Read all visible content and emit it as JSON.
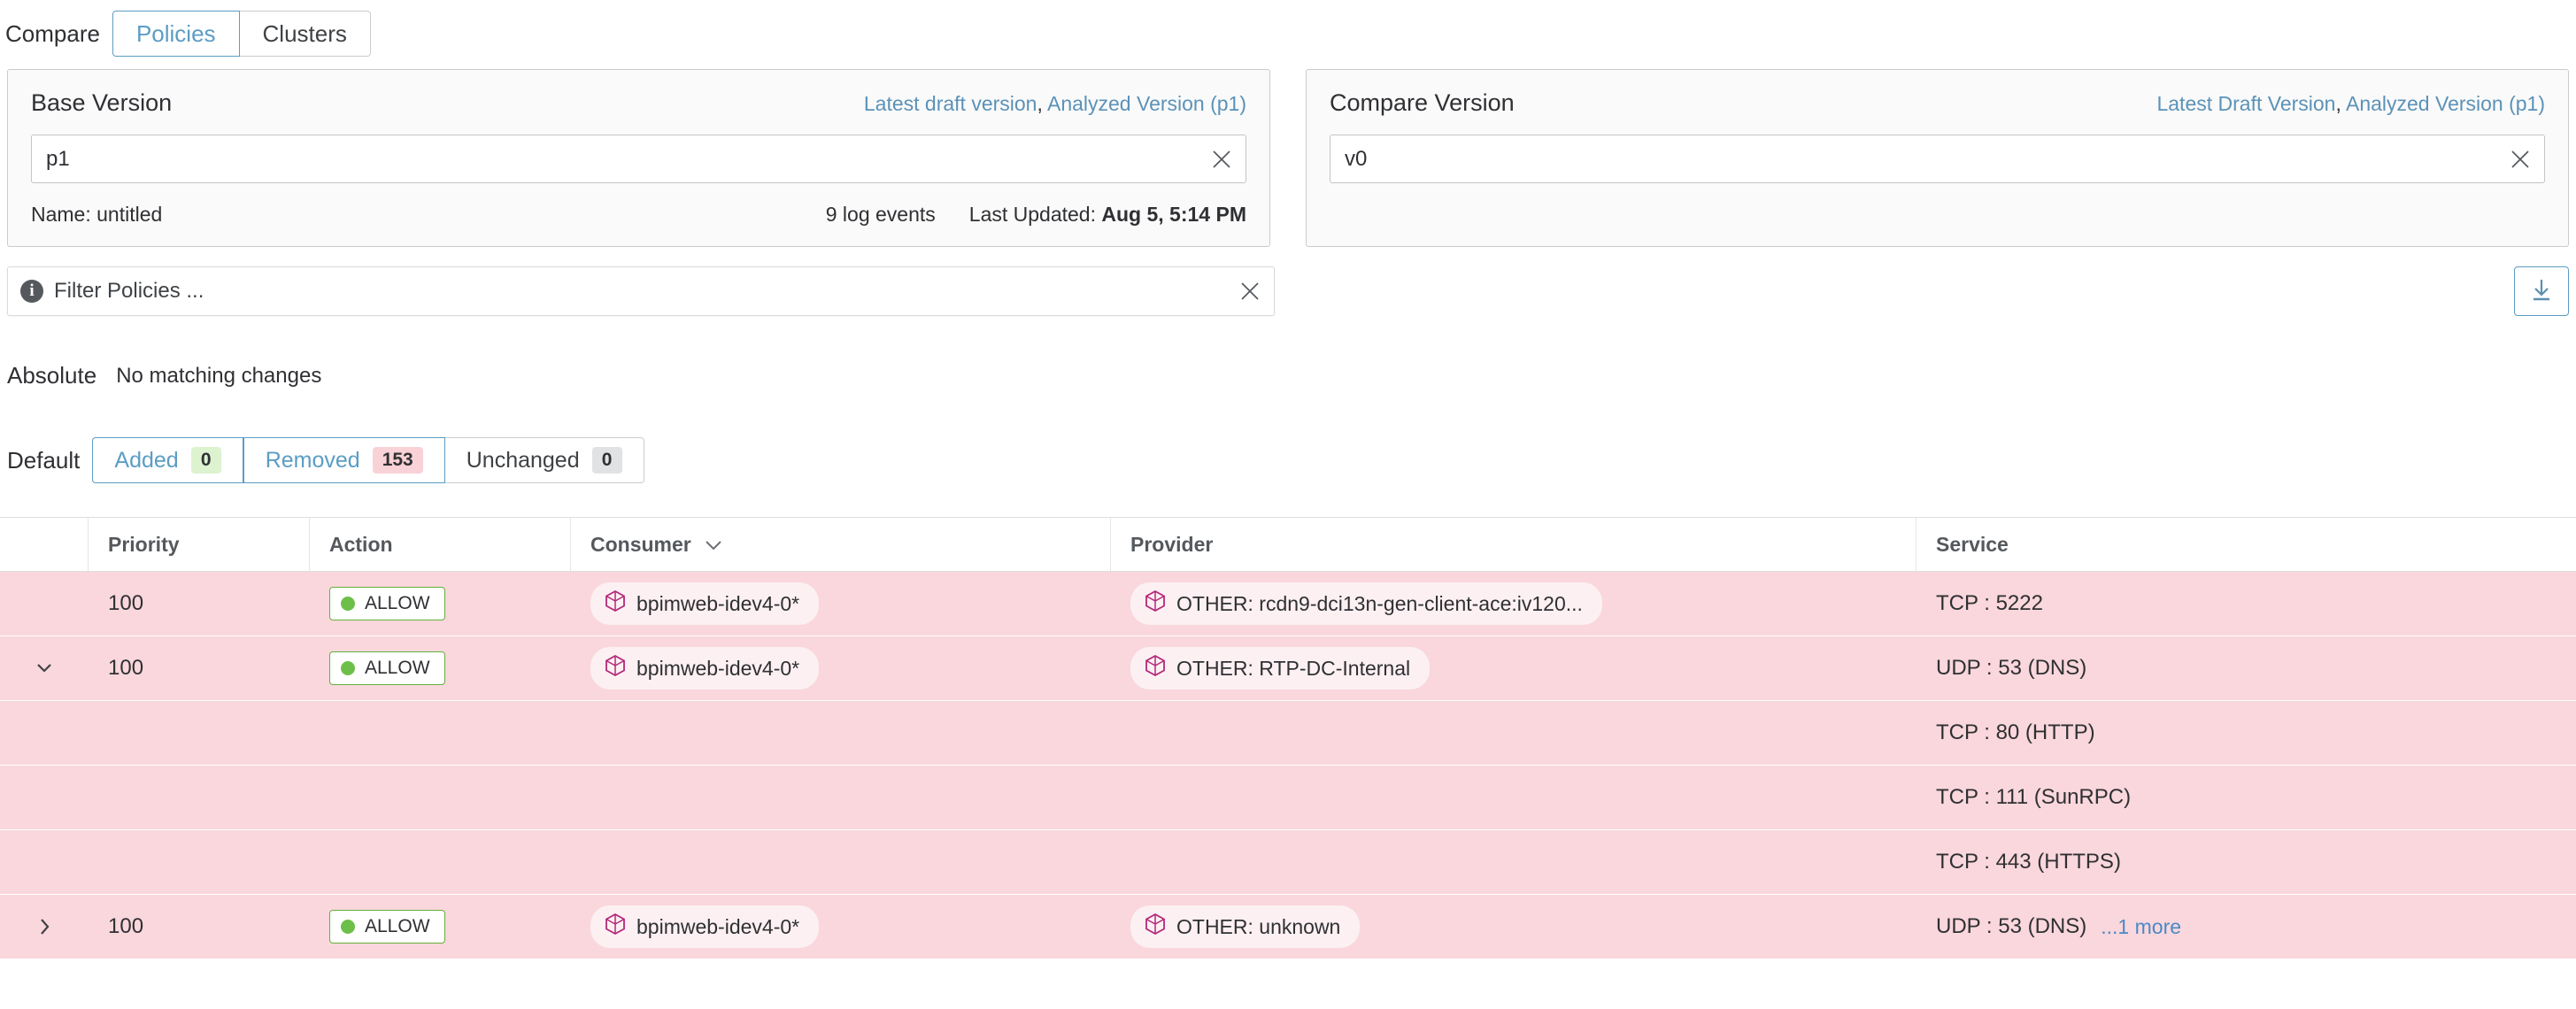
{
  "compare": {
    "label": "Compare",
    "tabs": [
      {
        "label": "Policies",
        "active": true
      },
      {
        "label": "Clusters",
        "active": false
      }
    ]
  },
  "base_version": {
    "title": "Base Version",
    "links": {
      "latest": "Latest draft version",
      "analyzed": "Analyzed Version (p1)",
      "separator": ","
    },
    "input": {
      "value": "p1",
      "placeholder": ""
    },
    "clear_icon": "close-icon",
    "meta": {
      "name": "Name: untitled",
      "log_events": "9 log events",
      "last_updated_label": "Last Updated:",
      "last_updated_value": "Aug 5, 5:14 PM"
    }
  },
  "compare_version": {
    "title": "Compare Version",
    "links": {
      "latest": "Latest Draft Version",
      "analyzed": "Analyzed Version (p1)",
      "separator": ","
    },
    "input": {
      "value": "v0",
      "placeholder": ""
    },
    "clear_icon": "close-icon"
  },
  "filter": {
    "info_icon": "info-icon",
    "placeholder": "Filter Policies ...",
    "value": "",
    "clear_icon": "close-icon",
    "download_icon": "download-icon"
  },
  "absolute": {
    "label": "Absolute",
    "message": "No matching changes"
  },
  "default_tabs": {
    "label": "Default",
    "tabs": [
      {
        "label": "Added",
        "count": "0",
        "badge": "green",
        "selected": true
      },
      {
        "label": "Removed",
        "count": "153",
        "badge": "red",
        "selected": true
      },
      {
        "label": "Unchanged",
        "count": "0",
        "badge": "grey",
        "selected": false
      }
    ]
  },
  "table": {
    "columns": [
      {
        "key": "expand",
        "label": ""
      },
      {
        "key": "priority",
        "label": "Priority"
      },
      {
        "key": "action",
        "label": "Action"
      },
      {
        "key": "consumer",
        "label": "Consumer",
        "sortable": true,
        "sort_icon": "chevron-down-icon"
      },
      {
        "key": "provider",
        "label": "Provider"
      },
      {
        "key": "service",
        "label": "Service"
      }
    ],
    "rows": [
      {
        "state": "removed",
        "expand": "none",
        "priority": "100",
        "action": "ALLOW",
        "consumer": "bpimweb-idev4-0*",
        "provider": "OTHER: rcdn9-dci13n-gen-client-ace:iv120...",
        "service": "TCP : 5222",
        "more": ""
      },
      {
        "state": "removed",
        "expand": "expanded",
        "priority": "100",
        "action": "ALLOW",
        "consumer": "bpimweb-idev4-0*",
        "provider": "OTHER: RTP-DC-Internal",
        "service": "UDP : 53 (DNS)",
        "more": ""
      },
      {
        "state": "removed",
        "expand": "none",
        "priority": "",
        "action": "",
        "consumer": "",
        "provider": "",
        "service": "TCP : 80 (HTTP)",
        "more": ""
      },
      {
        "state": "removed",
        "expand": "none",
        "priority": "",
        "action": "",
        "consumer": "",
        "provider": "",
        "service": "TCP : 111 (SunRPC)",
        "more": ""
      },
      {
        "state": "removed",
        "expand": "none",
        "priority": "",
        "action": "",
        "consumer": "",
        "provider": "",
        "service": "TCP : 443 (HTTPS)",
        "more": ""
      },
      {
        "state": "removed",
        "expand": "collapsed",
        "priority": "100",
        "action": "ALLOW",
        "consumer": "bpimweb-idev4-0*",
        "provider": "OTHER: unknown",
        "service": "UDP : 53 (DNS)",
        "more": "...1 more"
      }
    ]
  },
  "colors": {
    "accent_blue": "#5b9dc4",
    "link_blue": "#5b92b8",
    "removed_row": "#f9d7dc",
    "allow_green": "#6cc04a",
    "badge_green": "#ddf2cf",
    "badge_red": "#f8d2d6",
    "badge_grey": "#e1e2e4",
    "entity_chip": "#fcf0f2",
    "entity_icon": "#b3297a"
  }
}
